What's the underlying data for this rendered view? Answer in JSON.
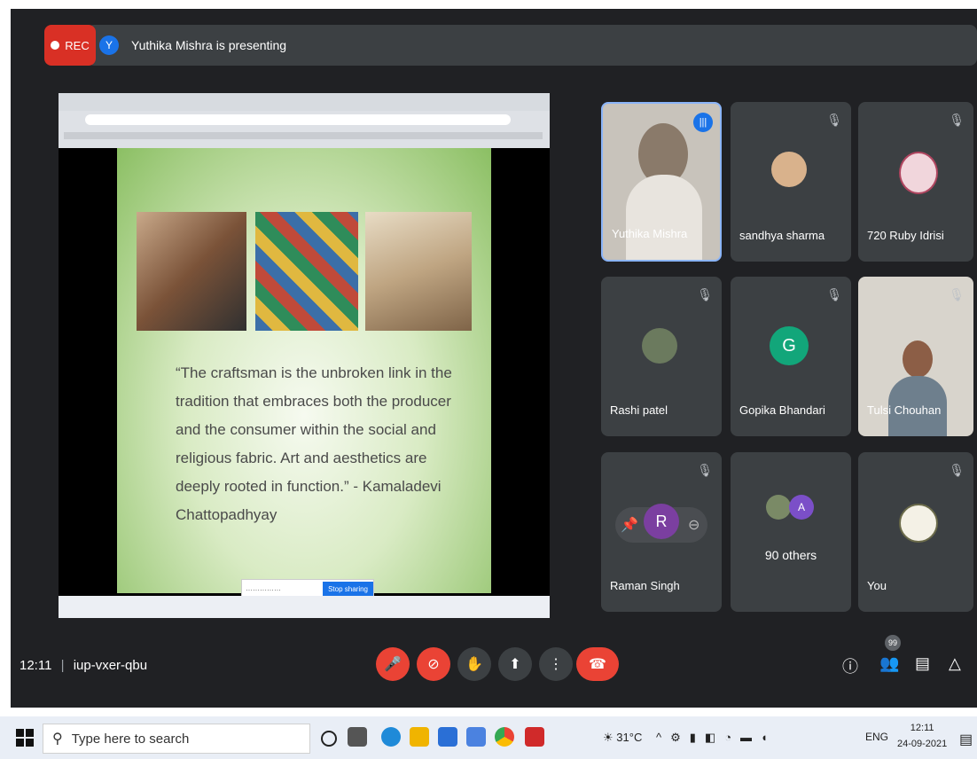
{
  "recording": {
    "label": "REC"
  },
  "presenter": {
    "initial": "Y",
    "banner": "Yuthika Mishra is presenting"
  },
  "slide": {
    "quote": "“The craftsman is the unbroken link in the tradition that embraces both the producer and the consumer within the social and religious fabric. Art and aesthetics are deeply rooted in function.” - Kamaladevi Chattopadhyay",
    "share_stop": "Stop sharing"
  },
  "participants": [
    {
      "name": "Yuthika Mishra",
      "speaking": true
    },
    {
      "name": "sandhya sharma",
      "muted": true
    },
    {
      "name": "720 Ruby Idrisi",
      "muted": true
    },
    {
      "name": "Rashi patel",
      "muted": true
    },
    {
      "name": "Gopika Bhandari",
      "initial": "G",
      "muted": true
    },
    {
      "name": "Tulsi Chouhan",
      "muted": true
    },
    {
      "name": "Raman Singh",
      "initial": "R",
      "muted": true
    },
    {
      "name": "90 others",
      "initial": "A"
    },
    {
      "name": "You",
      "muted": true
    }
  ],
  "meeting": {
    "time": "12:11",
    "code": "iup-vxer-qbu",
    "people_count": "99"
  },
  "taskbar": {
    "search_placeholder": "Type here to search",
    "weather": "31°C",
    "lang": "ENG",
    "time": "12:11",
    "date": "24-09-2021"
  }
}
